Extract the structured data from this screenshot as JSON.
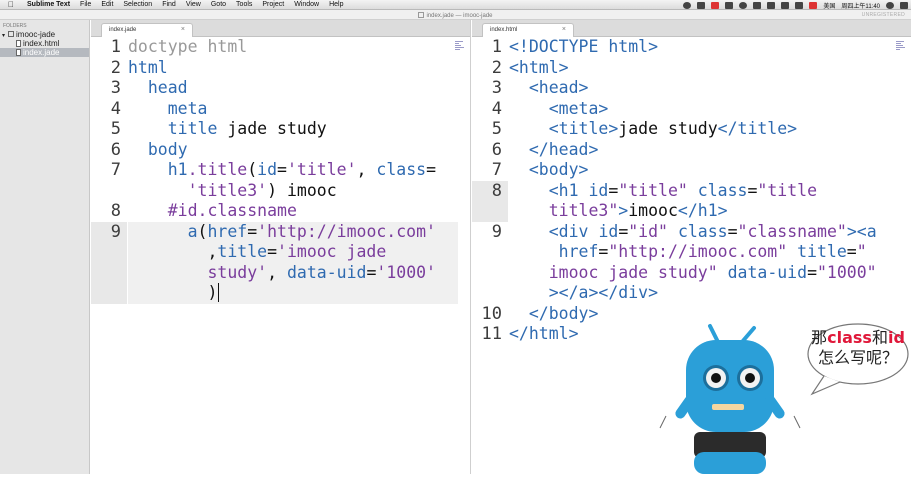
{
  "menubar": {
    "app": "Sublime Text",
    "items": [
      "File",
      "Edit",
      "Selection",
      "Find",
      "View",
      "Goto",
      "Tools",
      "Project",
      "Window",
      "Help"
    ],
    "input_source": "美国",
    "clock": "周四上午11:40"
  },
  "titlebar": {
    "title": "index.jade — imooc-jade",
    "badge": "UNREGISTERED"
  },
  "sidebar": {
    "header": "FOLDERS",
    "folder": "imooc-jade",
    "files": [
      "index.html",
      "index.jade"
    ]
  },
  "left_pane": {
    "tab": "index.jade",
    "line_numbers": [
      "1",
      "2",
      "3",
      "4",
      "5",
      "6",
      "7",
      "",
      "8",
      "9",
      "",
      "",
      ""
    ]
  },
  "right_pane": {
    "tab": "index.html",
    "line_numbers": [
      "1",
      "2",
      "3",
      "4",
      "5",
      "6",
      "7",
      "8",
      "",
      "9",
      "",
      "",
      "",
      "10",
      "11"
    ]
  },
  "bubble": {
    "pre": "那",
    "highlight1": "class",
    "mid": "和",
    "highlight2": "id",
    "line2": "怎么写呢？"
  },
  "colors": {
    "tag": "#2f6ab0",
    "string": "#7a3d9c",
    "comment_gray": "#999999",
    "bubble_red": "#e0183a",
    "robot_blue": "#2b9fd8"
  }
}
